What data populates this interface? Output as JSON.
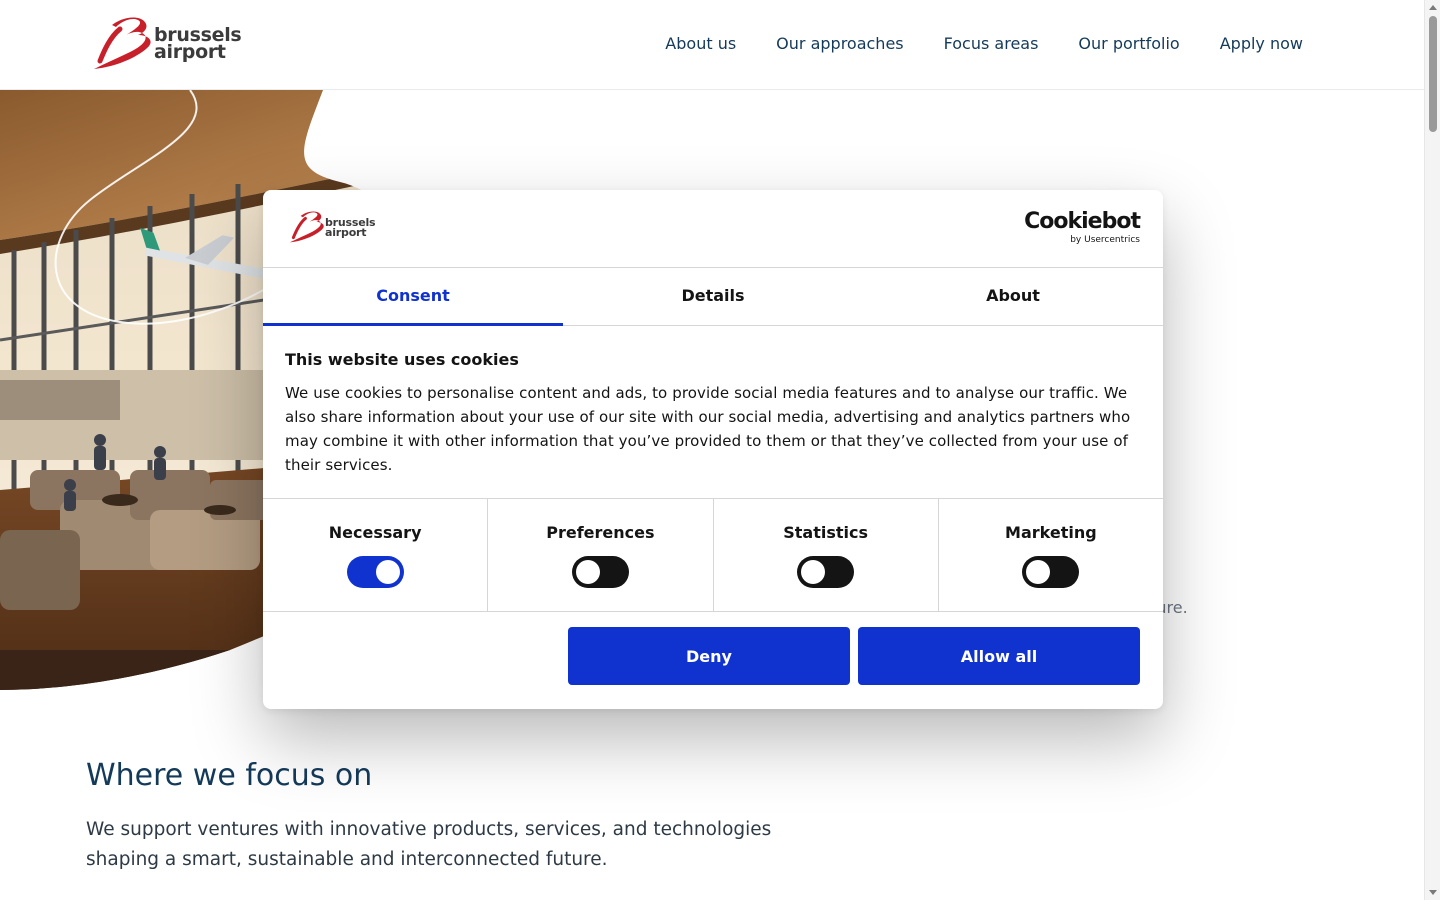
{
  "brand": {
    "name_line1": "brussels",
    "name_line2": "airport",
    "accent_color": "#c8202a"
  },
  "nav": {
    "items": [
      {
        "label": "About us"
      },
      {
        "label": "Our approaches"
      },
      {
        "label": "Focus areas"
      },
      {
        "label": "Our portfolio"
      },
      {
        "label": "Apply now"
      }
    ]
  },
  "hero": {
    "image": "airport-lounge-illustration",
    "lead_text_visible": "uture."
  },
  "focus": {
    "title": "Where we focus on",
    "text": "We support ventures with innovative products, services, and technologies shaping a smart, sustainable and interconnected future."
  },
  "cookie_dialog": {
    "provider_name": "Cookiebot",
    "provider_sub": "by Usercentrics",
    "tabs": [
      {
        "label": "Consent",
        "active": true
      },
      {
        "label": "Details",
        "active": false
      },
      {
        "label": "About",
        "active": false
      }
    ],
    "heading": "This website uses cookies",
    "body": "We use cookies to personalise content and ads, to provide social media features and to analyse our traffic. We also share information about your use of our site with our social media, advertising and analytics partners who may combine it with other information that you’ve provided to them or that they’ve collected from your use of their services.",
    "categories": [
      {
        "label": "Necessary",
        "enabled": true
      },
      {
        "label": "Preferences",
        "enabled": false
      },
      {
        "label": "Statistics",
        "enabled": false
      },
      {
        "label": "Marketing",
        "enabled": false
      }
    ],
    "buttons": {
      "deny": "Deny",
      "allow_all": "Allow all"
    },
    "colors": {
      "primary": "#1032cf",
      "toggle_off": "#141414"
    }
  }
}
